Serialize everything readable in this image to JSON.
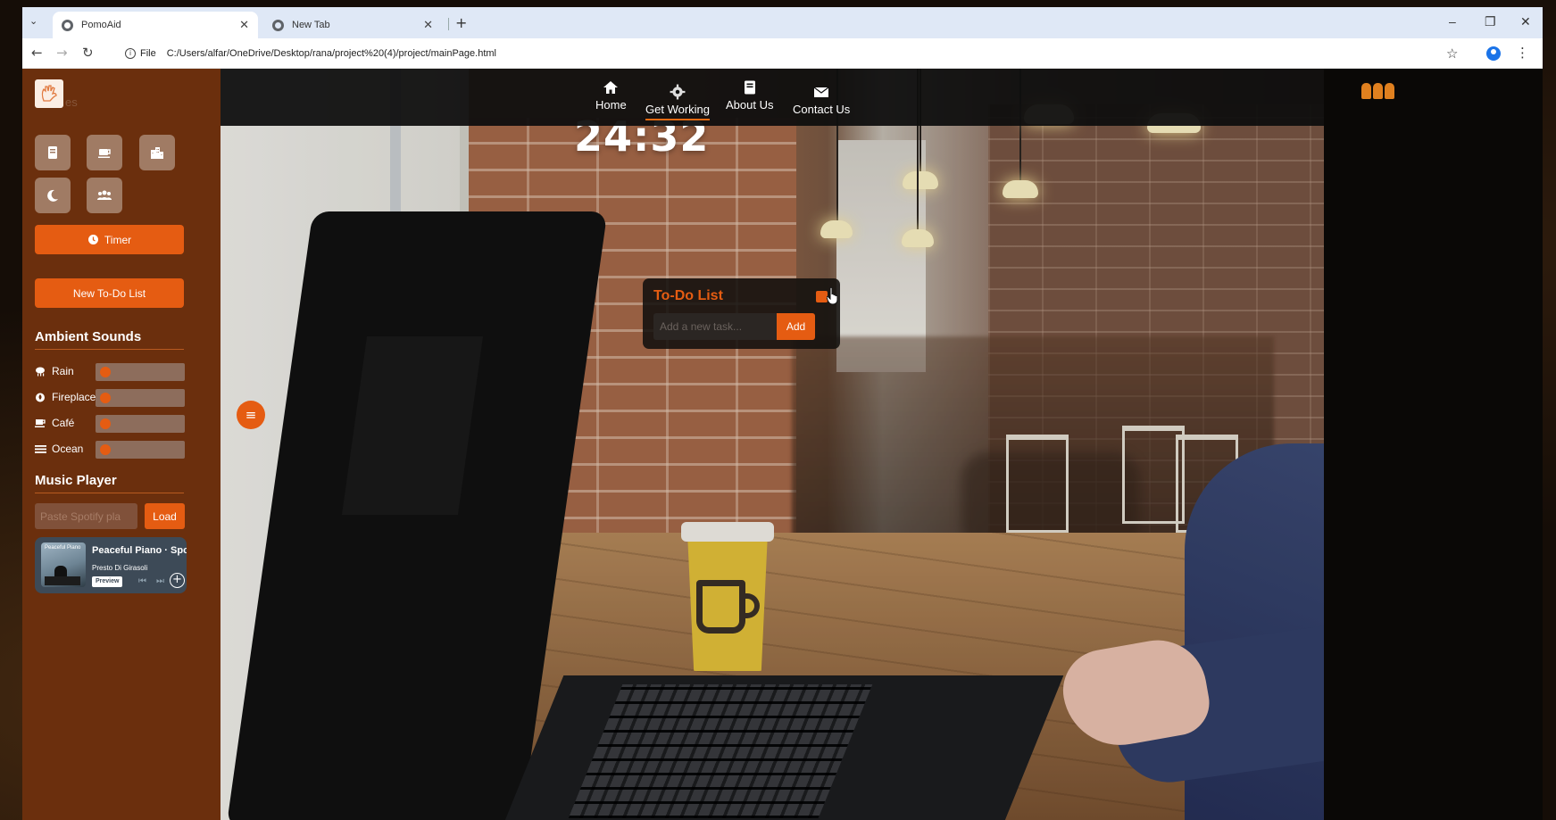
{
  "browser": {
    "tabs": [
      {
        "label": "PomoAid",
        "active": true
      },
      {
        "label": "New Tab",
        "active": false
      }
    ],
    "url_scheme": "File",
    "url": "C:/Users/alfar/OneDrive/Desktop/rana/project%20(4)/project/mainPage.html"
  },
  "navbar": {
    "items": [
      {
        "label": "Home",
        "icon": "home-icon"
      },
      {
        "label": "Get Working",
        "icon": "gear-icon",
        "active": true
      },
      {
        "label": "About Us",
        "icon": "book-icon"
      },
      {
        "label": "Contact Us",
        "icon": "envelope-icon"
      }
    ]
  },
  "timer": {
    "display": "24:32"
  },
  "sidebar": {
    "logo_ghost_text": "es",
    "themes": [
      {
        "icon": "book-icon"
      },
      {
        "icon": "coffee-icon"
      },
      {
        "icon": "city-icon"
      },
      {
        "icon": "moon-icon"
      },
      {
        "icon": "people-icon"
      }
    ],
    "timer_button": "Timer",
    "todo_button": "New To-Do List",
    "ambient_title": "Ambient Sounds",
    "sounds": [
      {
        "label": "Rain",
        "icon": "cloud-rain-icon",
        "level": 0
      },
      {
        "label": "Fireplace",
        "icon": "fire-icon",
        "level": 0
      },
      {
        "label": "Café",
        "icon": "coffee-icon",
        "level": 0
      },
      {
        "label": "Ocean",
        "icon": "water-icon",
        "level": 0
      }
    ],
    "music_title": "Music Player",
    "spotify_placeholder": "Paste Spotify pla",
    "load_button": "Load",
    "player": {
      "art_title": "Peaceful Piano",
      "title": "Peaceful Piano · Spo",
      "artist": "Presto Di Girasoli",
      "preview": "Preview"
    }
  },
  "todo": {
    "title": "To-Do List",
    "input_placeholder": "Add a new task...",
    "add_button": "Add"
  },
  "colors": {
    "accent": "#e55c12",
    "sidebar": "#6b2f0d",
    "navbar": "#0e0e0e",
    "theme_button": "#a07b64"
  }
}
